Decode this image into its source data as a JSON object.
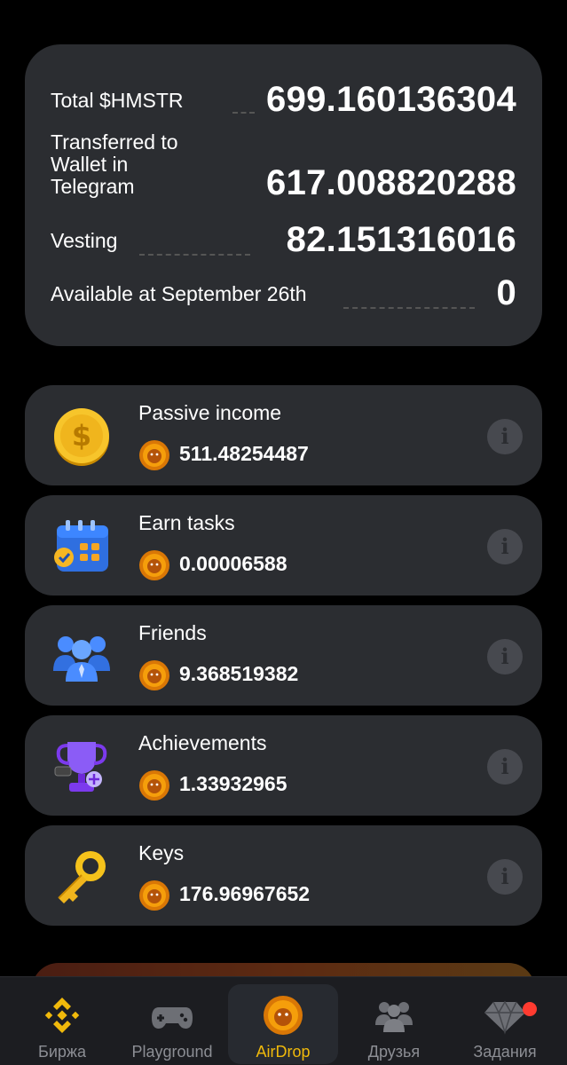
{
  "summary": {
    "total_label": "Total $HMSTR",
    "total_value": "699.160136304",
    "transferred_label_lines": [
      "Transferred to",
      "Wallet in",
      "Telegram"
    ],
    "transferred_value": "617.008820288",
    "vesting_label": "Vesting",
    "vesting_value": "82.151316016",
    "available_label": "Available at September 26th",
    "available_value": "0"
  },
  "cards": [
    {
      "title": "Passive income",
      "value": "511.48254487",
      "icon": "dollar-coin-icon"
    },
    {
      "title": "Earn tasks",
      "value": "0.00006588",
      "icon": "calendar-icon"
    },
    {
      "title": "Friends",
      "value": "9.368519382",
      "icon": "friends-icon"
    },
    {
      "title": "Achievements",
      "value": "1.33932965",
      "icon": "trophy-icon"
    },
    {
      "title": "Keys",
      "value": "176.96967652",
      "icon": "key-icon"
    }
  ],
  "nav": [
    {
      "label": "Биржа",
      "icon": "binance-icon",
      "active": false
    },
    {
      "label": "Playground",
      "icon": "gamepad-icon",
      "active": false
    },
    {
      "label": "AirDrop",
      "icon": "hamster-coin-icon",
      "active": true
    },
    {
      "label": "Друзья",
      "icon": "friends-icon",
      "active": false
    },
    {
      "label": "Задания",
      "icon": "diamond-icon",
      "active": false,
      "badge": true
    }
  ],
  "colors": {
    "accent": "#f0b90b",
    "card_bg": "#2b2d31",
    "background": "#000000",
    "badge": "#ff3b30"
  }
}
